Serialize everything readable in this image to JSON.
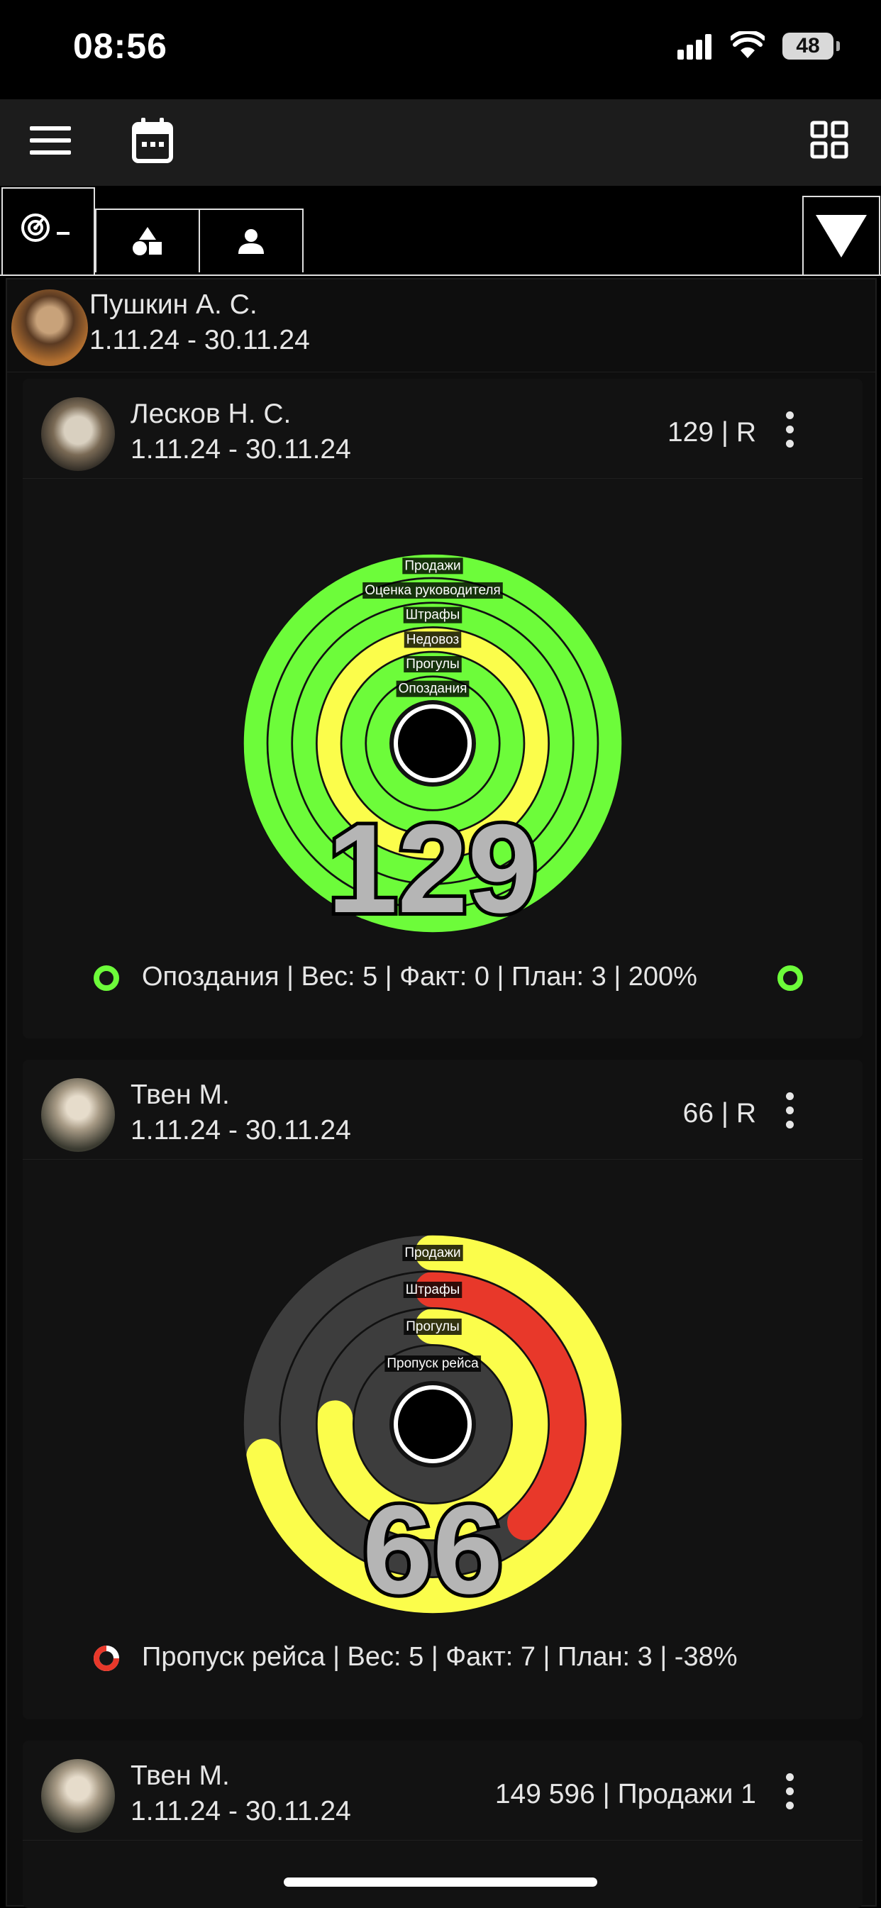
{
  "status_bar": {
    "time": "08:56",
    "battery": "48"
  },
  "header_card": {
    "name": "Пушкин А. С.",
    "period": "1.11.24 - 30.11.24"
  },
  "cards": [
    {
      "name": "Лесков Н. С.",
      "period": "1.11.24 - 30.11.24",
      "score": "129 | R",
      "total": "129",
      "rings": [
        {
          "label": "Продажи",
          "color": "#6dfc3a",
          "fraction": 1.0
        },
        {
          "label": "Оценка руководителя",
          "color": "#6dfc3a",
          "fraction": 1.0
        },
        {
          "label": "Штрафы",
          "color": "#6dfc3a",
          "fraction": 1.0
        },
        {
          "label": "Недовоз",
          "color": "#fbfd4b",
          "fraction": 1.0
        },
        {
          "label": "Прогулы",
          "color": "#6dfc3a",
          "fraction": 1.0
        },
        {
          "label": "Опоздания",
          "color": "#6dfc3a",
          "fraction": 1.0
        }
      ],
      "legend": "Опоздания | Вес: 5 | Факт: 0 | План: 3 | 200%"
    },
    {
      "name": "Твен М.",
      "period": "1.11.24 - 30.11.24",
      "score": "66 | R",
      "total": "66",
      "rings": [
        {
          "label": "Продажи",
          "color": "#fbfd4b",
          "fraction": 0.72
        },
        {
          "label": "Штрафы",
          "color": "#e8382a",
          "fraction": 0.38
        },
        {
          "label": "Прогулы",
          "color": "#fbfd4b",
          "fraction": 0.76
        },
        {
          "label": "Пропуск рейса",
          "color": "#3a3a3a",
          "fraction": 0.0
        }
      ],
      "legend": "Пропуск рейса | Вес: 5 | Факт: 7 | План: 3 | -38%"
    },
    {
      "name": "Твен М.",
      "period": "1.11.24 - 30.11.24",
      "score": "149 596 | Продажи 1"
    }
  ],
  "colors": {
    "green": "#6dfc3a",
    "yellow": "#fbfd4b",
    "red": "#e8382a",
    "track": "#3d3d3d"
  },
  "icons": [
    "menu-icon",
    "calendar-icon",
    "grid-icon",
    "radar-icon",
    "shapes-icon",
    "person-icon",
    "dropdown-triangle-icon",
    "kebab-icon"
  ]
}
